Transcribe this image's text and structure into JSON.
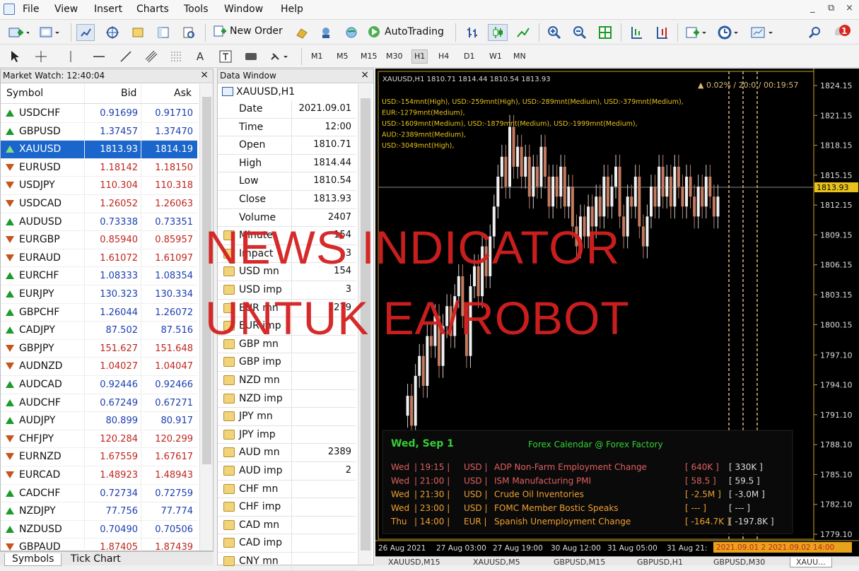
{
  "menu": [
    "File",
    "View",
    "Insert",
    "Charts",
    "Tools",
    "Window",
    "Help"
  ],
  "window_controls": [
    "_",
    "⧉",
    "×"
  ],
  "toolbar": {
    "new_order": "New Order",
    "auto_trading": "AutoTrading",
    "alert_count": "1"
  },
  "timeframes": [
    "M1",
    "M5",
    "M15",
    "M30",
    "H1",
    "H4",
    "D1",
    "W1",
    "MN"
  ],
  "selected_timeframe": "H1",
  "market_watch": {
    "title": "Market Watch: 12:40:04",
    "col_symbol": "Symbol",
    "col_bid": "Bid",
    "col_ask": "Ask",
    "rows": [
      {
        "symbol": "USDCHF",
        "bid": "0.91699",
        "ask": "0.91710",
        "dir": "up"
      },
      {
        "symbol": "GBPUSD",
        "bid": "1.37457",
        "ask": "1.37470",
        "dir": "up"
      },
      {
        "symbol": "XAUUSD",
        "bid": "1813.93",
        "ask": "1814.19",
        "dir": "up"
      },
      {
        "symbol": "EURUSD",
        "bid": "1.18142",
        "ask": "1.18150",
        "dir": "dn"
      },
      {
        "symbol": "USDJPY",
        "bid": "110.304",
        "ask": "110.318",
        "dir": "dn"
      },
      {
        "symbol": "USDCAD",
        "bid": "1.26052",
        "ask": "1.26063",
        "dir": "dn"
      },
      {
        "symbol": "AUDUSD",
        "bid": "0.73338",
        "ask": "0.73351",
        "dir": "up"
      },
      {
        "symbol": "EURGBP",
        "bid": "0.85940",
        "ask": "0.85957",
        "dir": "dn"
      },
      {
        "symbol": "EURAUD",
        "bid": "1.61072",
        "ask": "1.61097",
        "dir": "dn"
      },
      {
        "symbol": "EURCHF",
        "bid": "1.08333",
        "ask": "1.08354",
        "dir": "up"
      },
      {
        "symbol": "EURJPY",
        "bid": "130.323",
        "ask": "130.334",
        "dir": "up"
      },
      {
        "symbol": "GBPCHF",
        "bid": "1.26044",
        "ask": "1.26072",
        "dir": "up"
      },
      {
        "symbol": "CADJPY",
        "bid": "87.502",
        "ask": "87.516",
        "dir": "up"
      },
      {
        "symbol": "GBPJPY",
        "bid": "151.627",
        "ask": "151.648",
        "dir": "dn"
      },
      {
        "symbol": "AUDNZD",
        "bid": "1.04027",
        "ask": "1.04047",
        "dir": "dn"
      },
      {
        "symbol": "AUDCAD",
        "bid": "0.92446",
        "ask": "0.92466",
        "dir": "up"
      },
      {
        "symbol": "AUDCHF",
        "bid": "0.67249",
        "ask": "0.67271",
        "dir": "up"
      },
      {
        "symbol": "AUDJPY",
        "bid": "80.899",
        "ask": "80.917",
        "dir": "up"
      },
      {
        "symbol": "CHFJPY",
        "bid": "120.284",
        "ask": "120.299",
        "dir": "dn"
      },
      {
        "symbol": "EURNZD",
        "bid": "1.67559",
        "ask": "1.67617",
        "dir": "dn"
      },
      {
        "symbol": "EURCAD",
        "bid": "1.48923",
        "ask": "1.48943",
        "dir": "dn"
      },
      {
        "symbol": "CADCHF",
        "bid": "0.72734",
        "ask": "0.72759",
        "dir": "up"
      },
      {
        "symbol": "NZDJPY",
        "bid": "77.756",
        "ask": "77.774",
        "dir": "up"
      },
      {
        "symbol": "NZDUSD",
        "bid": "0.70490",
        "ask": "0.70506",
        "dir": "up"
      },
      {
        "symbol": "GBPAUD",
        "bid": "1.87405",
        "ask": "1.87439",
        "dir": "dn"
      }
    ],
    "tabs": [
      "Symbols",
      "Tick Chart"
    ]
  },
  "data_window": {
    "title": "Data Window",
    "symbol": "XAUUSD,H1",
    "rows": [
      {
        "label": "Date",
        "value": "2021.09.01",
        "icon": false
      },
      {
        "label": "Time",
        "value": "12:00",
        "icon": false
      },
      {
        "label": "Open",
        "value": "1810.71",
        "icon": false
      },
      {
        "label": "High",
        "value": "1814.44",
        "icon": false
      },
      {
        "label": "Low",
        "value": "1810.54",
        "icon": false
      },
      {
        "label": "Close",
        "value": "1813.93",
        "icon": false
      },
      {
        "label": "Volume",
        "value": "2407",
        "icon": false
      },
      {
        "label": "Minute",
        "value": "154",
        "icon": true
      },
      {
        "label": "Impact",
        "value": "3",
        "icon": true
      },
      {
        "label": "USD mn",
        "value": "154",
        "icon": true
      },
      {
        "label": "USD imp",
        "value": "3",
        "icon": true
      },
      {
        "label": "EUR mn",
        "value": "1279",
        "icon": true
      },
      {
        "label": "EUR imp",
        "value": "",
        "icon": true
      },
      {
        "label": "GBP mn",
        "value": "",
        "icon": true
      },
      {
        "label": "GBP imp",
        "value": "",
        "icon": true
      },
      {
        "label": "NZD mn",
        "value": "",
        "icon": true
      },
      {
        "label": "NZD imp",
        "value": "",
        "icon": true
      },
      {
        "label": "JPY mn",
        "value": "",
        "icon": true
      },
      {
        "label": "JPY imp",
        "value": "",
        "icon": true
      },
      {
        "label": "AUD mn",
        "value": "2389",
        "icon": true
      },
      {
        "label": "AUD imp",
        "value": "2",
        "icon": true
      },
      {
        "label": "CHF mn",
        "value": "",
        "icon": true
      },
      {
        "label": "CHF imp",
        "value": "",
        "icon": true
      },
      {
        "label": "CAD mn",
        "value": "",
        "icon": true
      },
      {
        "label": "CAD imp",
        "value": "",
        "icon": true
      },
      {
        "label": "CNY mn",
        "value": "",
        "icon": true
      }
    ]
  },
  "chart": {
    "header": "XAUUSD,H1  1810.71 1814.44 1810.54 1813.93",
    "countdown": "▲ 0.02% / 20:0 / 00:19:57",
    "news_lines": [
      "USD:-154mnt(High), USD:-259mnt(High), USD:-289mnt(Medium), USD:-379mnt(Medium),",
      "EUR:-1279mnt(Medium),",
      "USD:-1609mnt(Medium), USD:-1879mnt(Medium), USD:-1999mnt(Medium),",
      "AUD:-2389mnt(Medium),",
      "USD:-3049mnt(High),"
    ],
    "price_levels": [
      "1824.15",
      "1821.15",
      "1818.15",
      "1815.15",
      "1812.15",
      "1809.15",
      "1806.15",
      "1803.15",
      "1800.15",
      "1797.10",
      "1794.10",
      "1791.10",
      "1788.10",
      "1785.10",
      "1782.10",
      "1779.10"
    ],
    "current_price": "1813.93",
    "time_labels": [
      "26 Aug 2021",
      "27 Aug 03:00",
      "27 Aug 19:00",
      "30 Aug 12:00",
      "31 Aug 05:00",
      "31 Aug 21:"
    ],
    "time_highlight": "2021.09.01 2 2021.09.02 14:00",
    "calendar": {
      "day": "Wed, Sep 1",
      "title": "Forex Calendar @ Forex Factory",
      "events": [
        {
          "day": "Wed",
          "time": "19:15",
          "cur": "USD",
          "name": "ADP Non-Farm Employment Change",
          "f": "[ 640K ]",
          "p": "[ 330K ]",
          "color": "#e06060"
        },
        {
          "day": "Wed",
          "time": "21:00",
          "cur": "USD",
          "name": "ISM Manufacturing PMI",
          "f": "[ 58.5 ]",
          "p": "[ 59.5 ]",
          "color": "#e06060"
        },
        {
          "day": "Wed",
          "time": "21:30",
          "cur": "USD",
          "name": "Crude Oil Inventories",
          "f": "[ -2.5M ]",
          "p": "[ -3.0M ]",
          "color": "#f0a030"
        },
        {
          "day": "Wed",
          "time": "23:00",
          "cur": "USD",
          "name": "FOMC Member Bostic Speaks",
          "f": "[ --- ]",
          "p": "[ --- ]",
          "color": "#f0a030"
        },
        {
          "day": "Thu",
          "time": "14:00",
          "cur": "EUR",
          "name": "Spanish Unemployment Change",
          "f": "[ -164.7K ]",
          "p": "[ -197.8K ]",
          "color": "#f0a030"
        }
      ]
    }
  },
  "chart_tabs": [
    "XAUUSD,M15",
    "XAUUSD,M5",
    "GBPUSD,M15",
    "GBPUSD,H1",
    "GBPUSD,M30",
    "XAUU..."
  ],
  "watermark": [
    "NEWS INDICATOR",
    "UNTUK EA/ROBOT"
  ],
  "colors": {
    "up": "#1c9a2a",
    "down": "#c6541c",
    "selection": "#1a66cc",
    "watermark": "#d42020",
    "chart_bg": "#000000",
    "axis": "#c9a227"
  }
}
